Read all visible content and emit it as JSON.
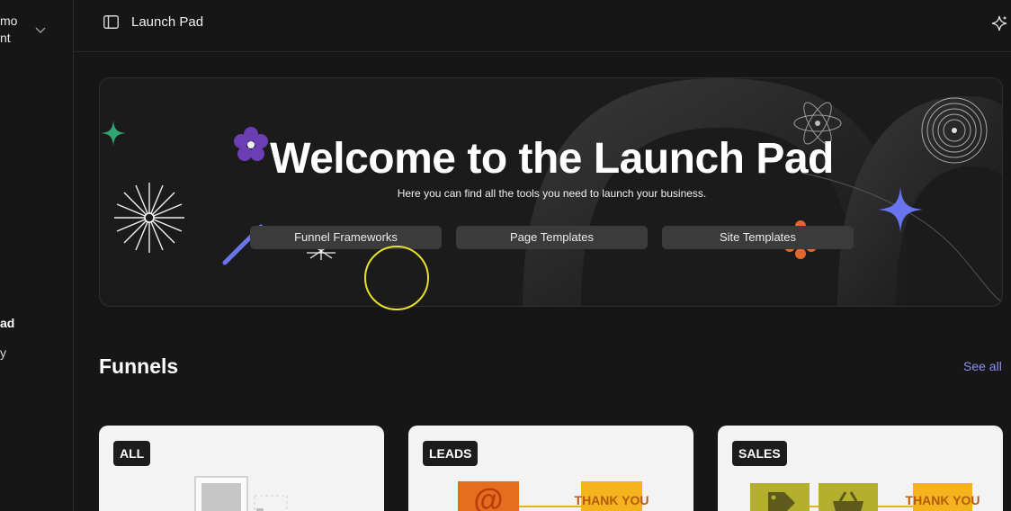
{
  "sidebar": {
    "workspace_line1": "mo",
    "workspace_line2": "nt",
    "items": [
      {
        "label": "ad",
        "active": true
      },
      {
        "label": "y",
        "active": false
      }
    ]
  },
  "header": {
    "title": "Launch Pad",
    "icon_left": "sidebar-toggle-icon",
    "icon_right": "sparkle-icon"
  },
  "hero": {
    "title": "Welcome to the Launch Pad",
    "subtitle": "Here you can find all the tools you need to launch your business.",
    "buttons": [
      {
        "label": "Funnel Frameworks"
      },
      {
        "label": "Page Templates"
      },
      {
        "label": "Site Templates"
      }
    ]
  },
  "funnels": {
    "title": "Funnels",
    "see_all": "See all",
    "cards": [
      {
        "tag": "ALL"
      },
      {
        "tag": "LEADS"
      },
      {
        "tag": "SALES"
      }
    ],
    "thank_you_text": "THANK YOU"
  },
  "colors": {
    "background": "#161616",
    "accent_link": "#8c8ff2",
    "card_bg": "#f3f3f3",
    "cursor_ring": "#e7e02a"
  }
}
